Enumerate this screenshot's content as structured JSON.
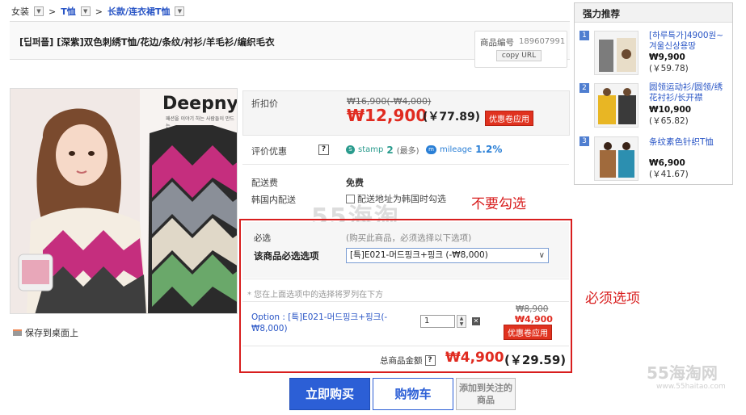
{
  "breadcrumb": {
    "level1": "女装",
    "level2": "T恤",
    "level3": "长款/连衣裙T恤"
  },
  "product": {
    "title": "[딥퍼플] [深紫]双色刺绣T恤/花边/条纹/衬衫/羊毛衫/编织毛衣",
    "code_label": "商品编号",
    "code_value": "189607991",
    "copy_label": "copy URL",
    "brand_on_image": "Deepny",
    "brand_tagline": "패션을 이야기 하는 사람들이 만드는",
    "save_desktop": "保存到桌面上"
  },
  "pricing": {
    "discount_label": "折扣价",
    "original": "₩16,900(-₩4,000)",
    "price": "₩12,900",
    "price_cny": "(￥77.89)",
    "coupon_button": "优惠卷应用",
    "benefit_label": "评价优惠",
    "help": "?",
    "stamp_icon": "S",
    "stamp_label": "stamp",
    "stamp_value": "2",
    "stamp_max": "(最多)",
    "mileage_icon": "m",
    "mileage_label": "mileage",
    "mileage_value": "1.2%",
    "shipping_label": "配送费",
    "shipping_value": "免费",
    "korea_shipping_label": "韩国内配送",
    "korea_shipping_option": "配送地址为韩国时勾选"
  },
  "options": {
    "required_label": "必选",
    "required_hint": "(购买此商品，必须选择以下选项)",
    "must_select_label": "该商品必选选项",
    "selected_value": "[특]E021-머드핑크+핑크 (-₩8,000)",
    "select_arrow": "∨",
    "note": "* 您在上面选项中的选择将罗列在下方",
    "item_text": "Option : [특]E021-머드핑크+핑크(-₩8,000)",
    "quantity": "1",
    "spin_up": "▲",
    "spin_down": "▼",
    "remove": "✕",
    "item_orig": "₩8,900",
    "item_price": "₩4,900",
    "item_coupon": "优惠卷应用",
    "total_label": "总商品金额",
    "total_price": "₩4,900",
    "total_cny": "(￥29.59)"
  },
  "buttons": {
    "buy_now": "立即购买",
    "cart": "购物车",
    "favorite": "添加到关注的商品"
  },
  "annotations": {
    "dont_check": "不要勾选",
    "must_option": "必须选项",
    "watermark_center": "55海淘",
    "watermark_corner": "55海淘网",
    "watermark_url": "www.55haitao.com"
  },
  "recommend": {
    "title": "强力推荐",
    "items": [
      {
        "rank": "1",
        "name": "[하루특가]4900원~겨울신상용땅",
        "price": "₩9,900",
        "cny": "(￥59.78)"
      },
      {
        "rank": "2",
        "name": "圆领运动衫/圆领/绣花衬衫/长开襟",
        "price": "₩10,900",
        "cny": "(￥65.82)"
      },
      {
        "rank": "3",
        "name": "条纹素色针织T恤",
        "price": "₩6,900",
        "cny": "(￥41.67)"
      }
    ]
  },
  "colors": {
    "link": "#2a56c6",
    "price_red": "#e02b20",
    "annotation_red": "#d81e1e",
    "button_blue": "#2c5fd6"
  }
}
